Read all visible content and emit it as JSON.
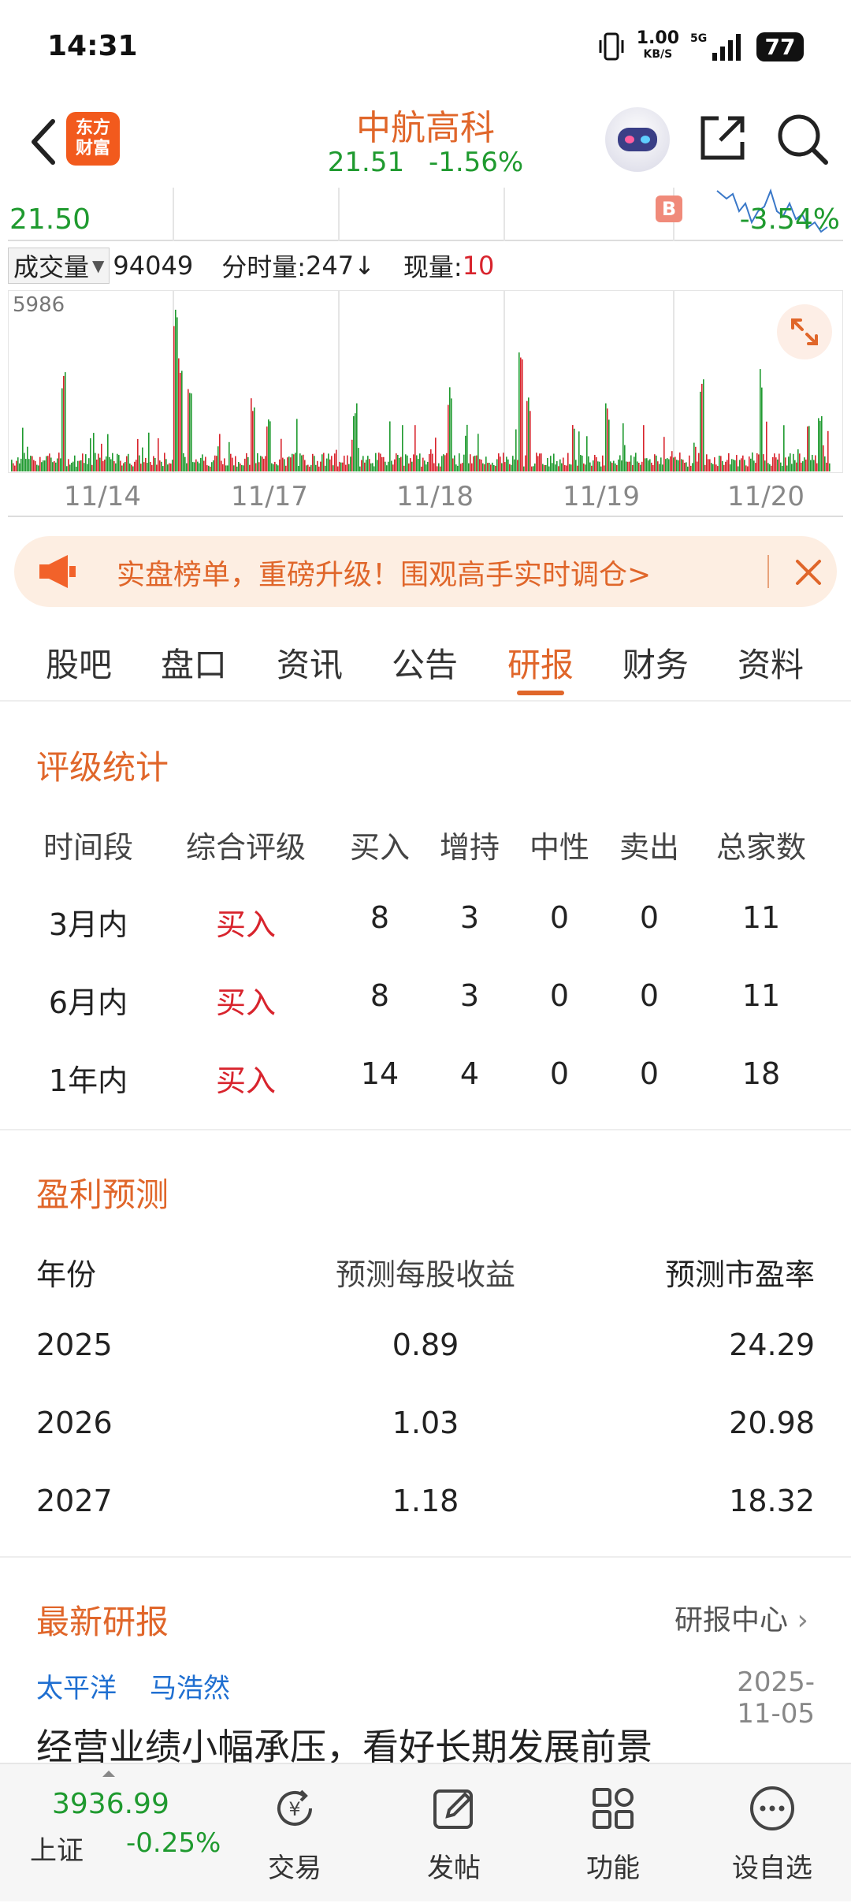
{
  "status_bar": {
    "time": "14:31",
    "net_speed_top": "1.00",
    "net_speed_unit": "KB/S",
    "network": "5G",
    "battery": "77"
  },
  "header": {
    "logo_line1": "东方",
    "logo_line2": "财富",
    "stock_name": "中航高科",
    "price": "21.51",
    "change_pct": "-1.56%"
  },
  "chart": {
    "price_label": "21.50",
    "pct_label": "-3.54%",
    "marker": "B",
    "volume_select": "成交量",
    "volume_value": "94049",
    "tick_volume_label": "分时量:",
    "tick_volume_value": "247↓",
    "current_volume_label": "现量:",
    "current_volume_value": "10",
    "volume_max": "5986",
    "dates": [
      "11/14",
      "11/17",
      "11/18",
      "11/19",
      "11/20"
    ]
  },
  "banner": {
    "text": "实盘榜单，重磅升级！围观高手实时调仓>"
  },
  "tabs": [
    "股吧",
    "盘口",
    "资讯",
    "公告",
    "研报",
    "财务",
    "资料"
  ],
  "active_tab": "研报",
  "rating": {
    "title": "评级统计",
    "headers": [
      "时间段",
      "综合评级",
      "买入",
      "增持",
      "中性",
      "卖出",
      "总家数"
    ],
    "rows": [
      [
        "3月内",
        "买入",
        "8",
        "3",
        "0",
        "0",
        "11"
      ],
      [
        "6月内",
        "买入",
        "8",
        "3",
        "0",
        "0",
        "11"
      ],
      [
        "1年内",
        "买入",
        "14",
        "4",
        "0",
        "0",
        "18"
      ]
    ]
  },
  "forecast": {
    "title": "盈利预测",
    "headers": [
      "年份",
      "预测每股收益",
      "预测市盈率"
    ],
    "rows": [
      [
        "2025",
        "0.89",
        "24.29"
      ],
      [
        "2026",
        "1.03",
        "20.98"
      ],
      [
        "2027",
        "1.18",
        "18.32"
      ]
    ]
  },
  "reports": {
    "title": "最新研报",
    "center_link": "研报中心",
    "authors": [
      "太平洋",
      "马浩然"
    ],
    "date": "2025-11-05",
    "headline": "经营业绩小幅承压，看好长期发展前景"
  },
  "bottom_nav": {
    "index_value": "3936.99",
    "index_name": "上证",
    "index_change": "-0.25%",
    "items": [
      "交易",
      "发帖",
      "功能",
      "设自选"
    ]
  },
  "colors": {
    "accent": "#e0662a",
    "down": "#1f9a2f",
    "up": "#d8242d",
    "link": "#1f6fd1"
  }
}
